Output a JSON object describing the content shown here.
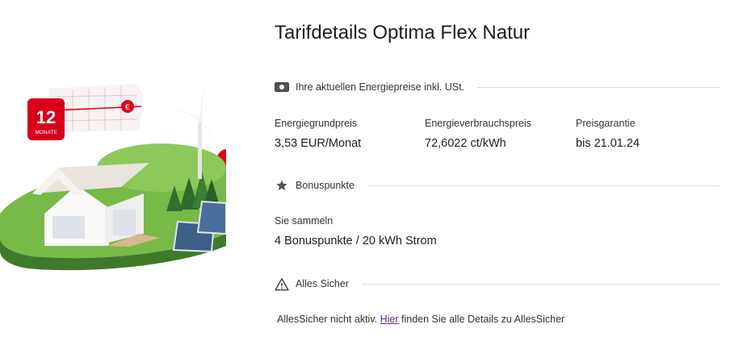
{
  "page": {
    "title": "Tarifdetails Optima Flex Natur"
  },
  "illustration": {
    "badge_number": "12",
    "badge_unit": "MONATE",
    "tag_symbol": "€",
    "accent_color": "#e2001a"
  },
  "prices": {
    "heading": "Ihre aktuellen Energiepreise inkl. USt.",
    "heading_icon": "money-icon",
    "items": [
      {
        "label": "Energiegrundpreis",
        "value": "3,53 EUR/Monat"
      },
      {
        "label": "Energieverbrauchspreis",
        "value": "72,6022 ct/kWh"
      },
      {
        "label": "Preisgarantie",
        "value": "bis 21.01.24"
      }
    ]
  },
  "bonus": {
    "heading": "Bonuspunkte",
    "heading_icon": "star-icon",
    "label": "Sie sammeln",
    "value": "4 Bonuspunkte / 20 kWh Strom"
  },
  "alles_sicher": {
    "heading": "Alles Sicher",
    "heading_icon": "warning-icon",
    "note_before": "AllesSicher nicht aktiv. ",
    "link_text": "Hier",
    "note_after": " finden Sie alle Details zu AllesSicher"
  }
}
